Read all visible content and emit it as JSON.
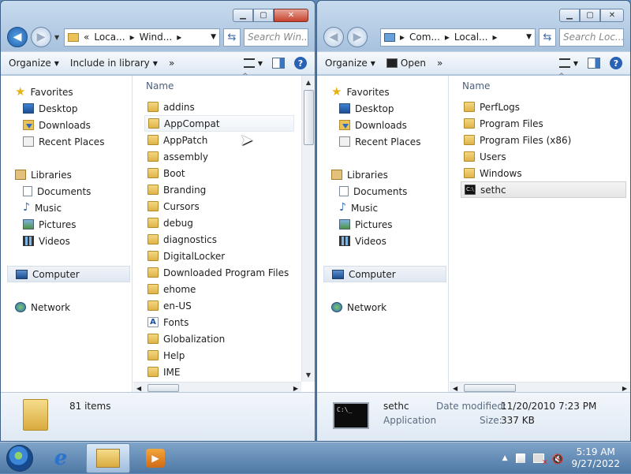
{
  "left_window": {
    "address_parts": [
      "Loca...",
      "Wind..."
    ],
    "search_placeholder": "Search Win...",
    "toolbar": {
      "organize": "Organize",
      "include": "Include in library"
    },
    "nav": {
      "favorites": "Favorites",
      "desktop": "Desktop",
      "downloads": "Downloads",
      "recent": "Recent Places",
      "libraries": "Libraries",
      "documents": "Documents",
      "music": "Music",
      "pictures": "Pictures",
      "videos": "Videos",
      "computer": "Computer",
      "network": "Network"
    },
    "column_name": "Name",
    "files": [
      "addins",
      "AppCompat",
      "AppPatch",
      "assembly",
      "Boot",
      "Branding",
      "Cursors",
      "debug",
      "diagnostics",
      "DigitalLocker",
      "Downloaded Program Files",
      "ehome",
      "en-US",
      "Fonts",
      "Globalization",
      "Help",
      "IME"
    ],
    "item_count": "81 items"
  },
  "right_window": {
    "address_parts": [
      "Com...",
      "Local..."
    ],
    "search_placeholder": "Search Loc...",
    "toolbar": {
      "organize": "Organize",
      "open": "Open"
    },
    "nav": {
      "favorites": "Favorites",
      "desktop": "Desktop",
      "downloads": "Downloads",
      "recent": "Recent Places",
      "libraries": "Libraries",
      "documents": "Documents",
      "music": "Music",
      "pictures": "Pictures",
      "videos": "Videos",
      "computer": "Computer",
      "network": "Network"
    },
    "column_name": "Name",
    "files": [
      "PerfLogs",
      "Program Files",
      "Program Files (x86)",
      "Users",
      "Windows",
      "sethc"
    ],
    "details": {
      "name": "sethc",
      "type": "Application",
      "date_label": "Date modified:",
      "date_value": "11/20/2010 7:23 PM",
      "size_label": "Size:",
      "size_value": "337 KB"
    }
  },
  "taskbar": {
    "time": "5:19 AM",
    "date": "9/27/2022"
  }
}
